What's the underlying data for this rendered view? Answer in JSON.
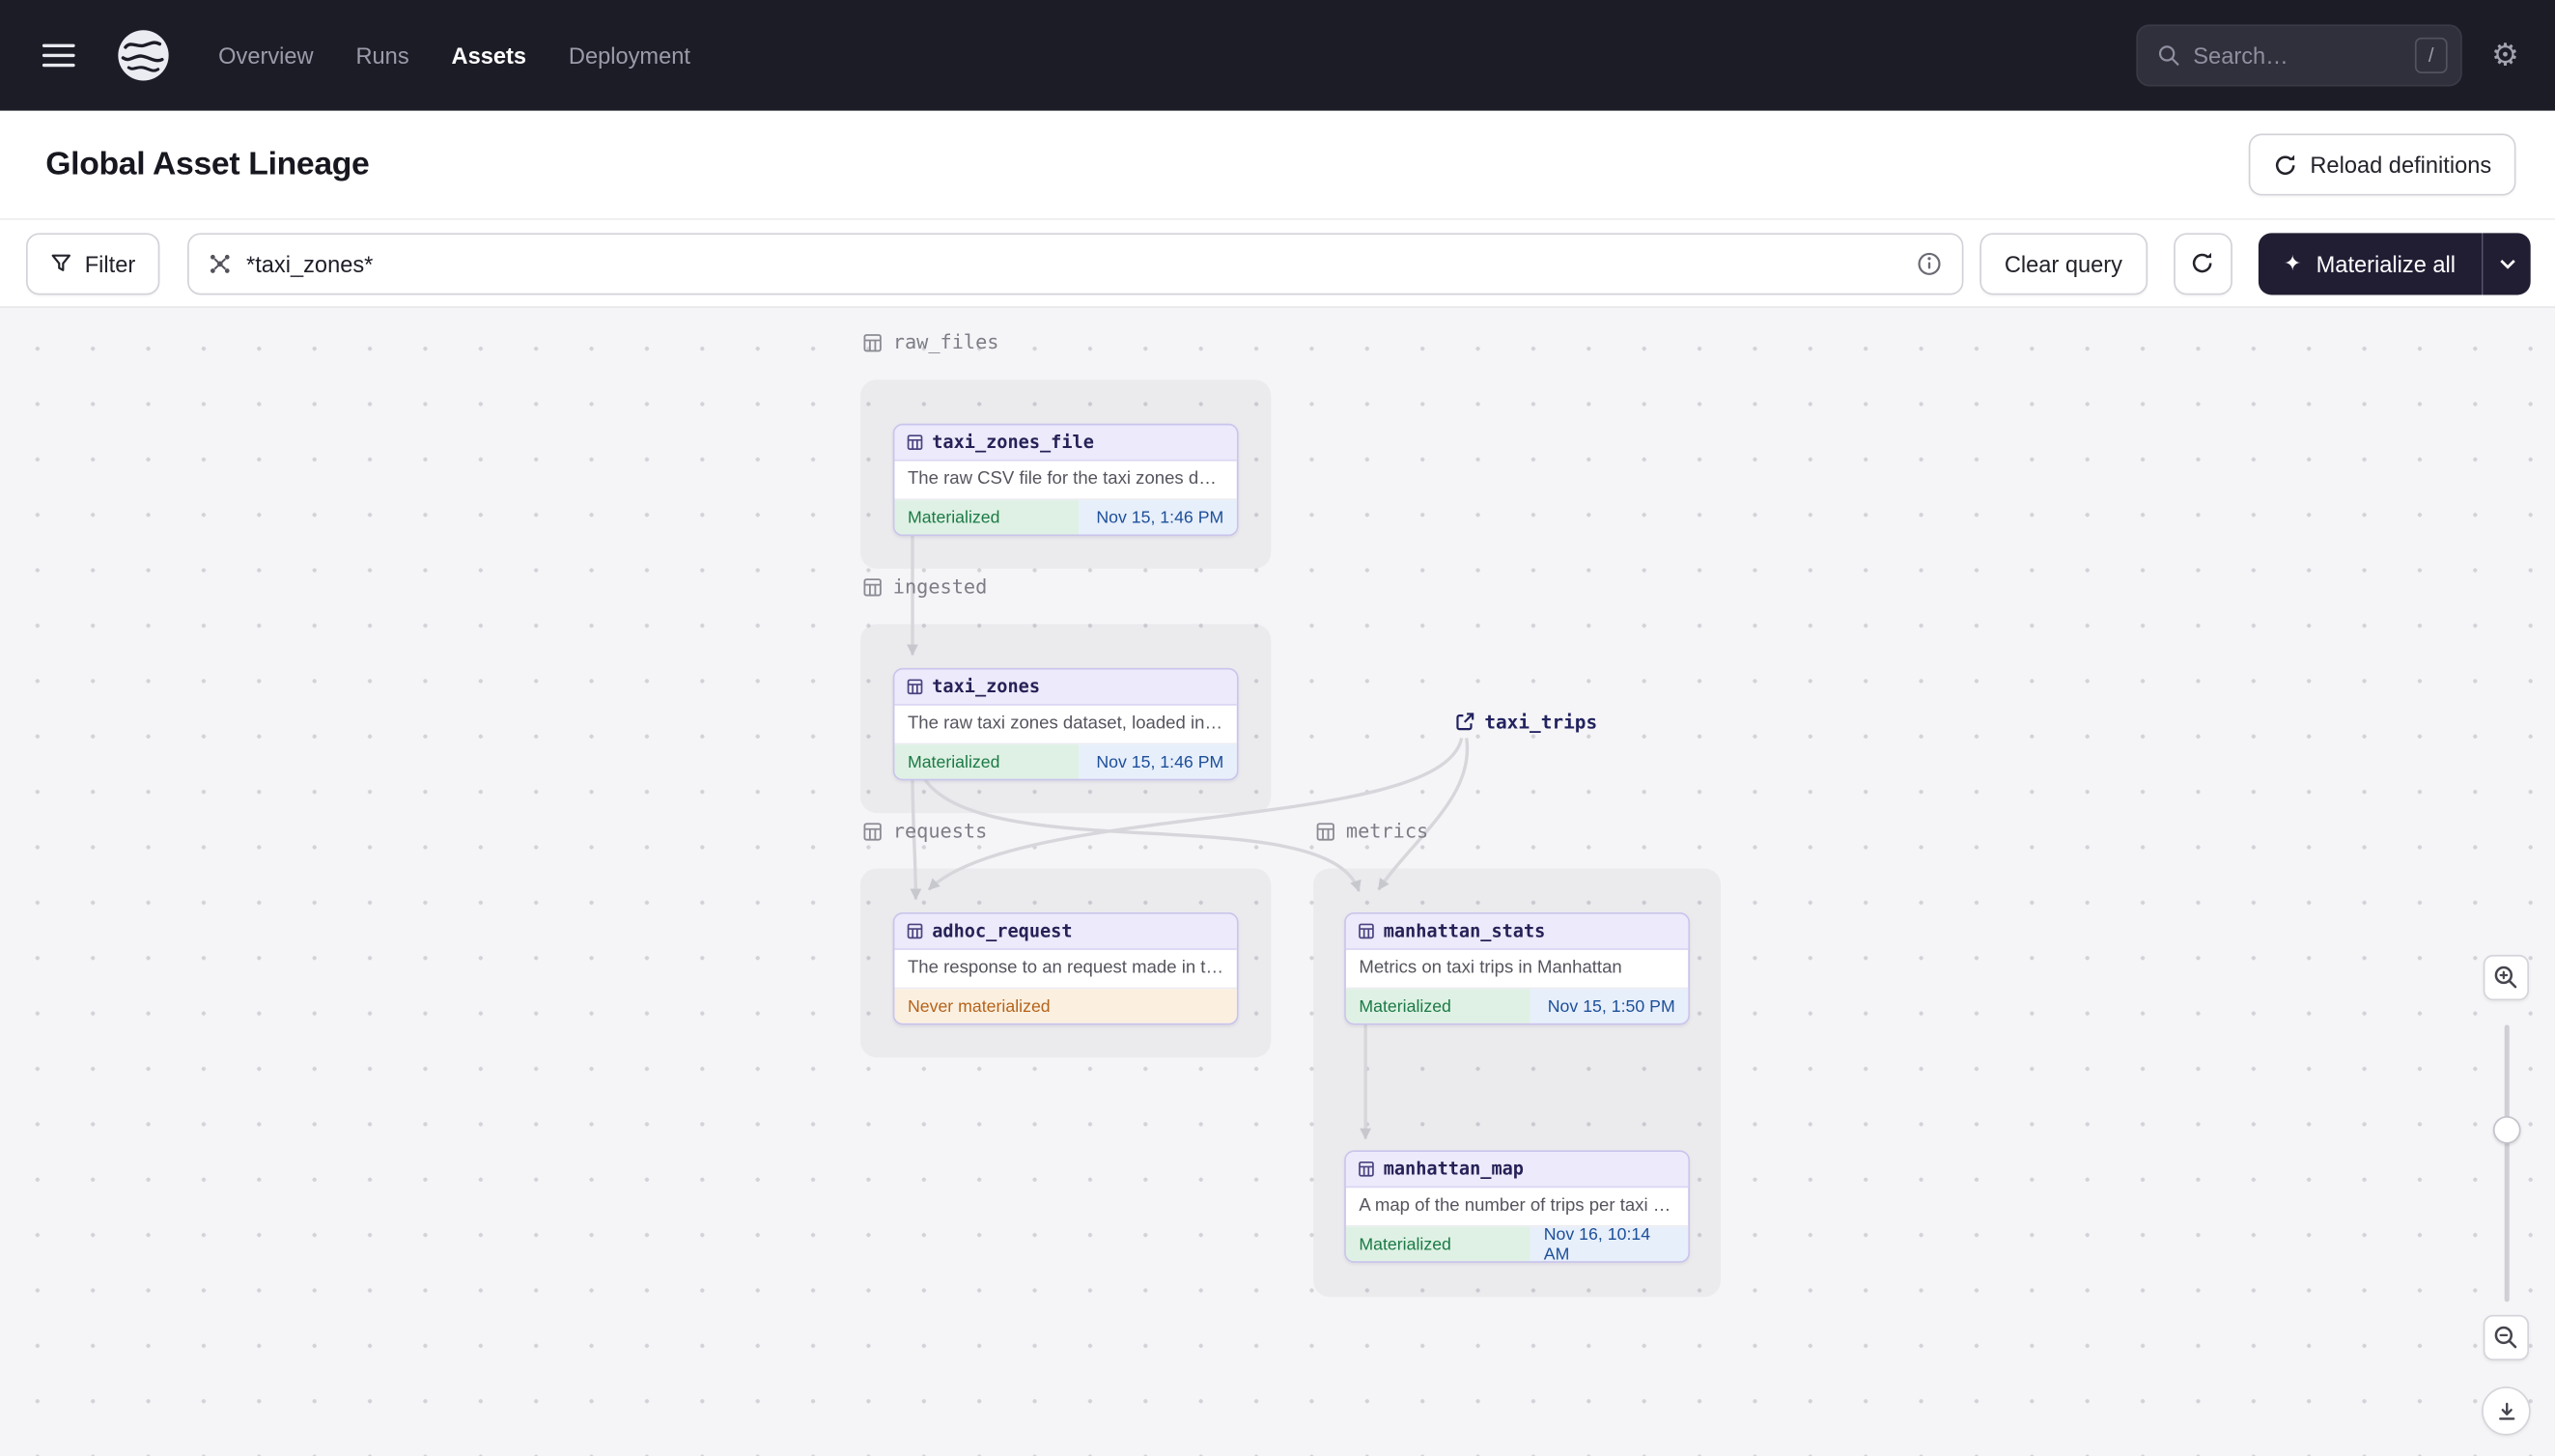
{
  "topbar": {
    "nav_items": [
      {
        "label": "Overview"
      },
      {
        "label": "Runs"
      },
      {
        "label": "Assets"
      },
      {
        "label": "Deployment"
      }
    ],
    "search_placeholder": "Search…",
    "search_shortcut": "/"
  },
  "header": {
    "title": "Global Asset Lineage",
    "reload_button_label": "Reload definitions"
  },
  "toolbar": {
    "filter_label": "Filter",
    "query_value": "*taxi_zones*",
    "clear_query_label": "Clear query",
    "materialize_label": "Materialize all"
  },
  "graph": {
    "groups": [
      {
        "name": "raw_files"
      },
      {
        "name": "ingested"
      },
      {
        "name": "requests"
      },
      {
        "name": "metrics"
      }
    ],
    "external": {
      "name": "taxi_trips"
    },
    "nodes": [
      {
        "name": "taxi_zones_file",
        "description": "The raw CSV file for the taxi zones dat…",
        "status": "Materialized",
        "timestamp": "Nov 15, 1:46 PM"
      },
      {
        "name": "taxi_zones",
        "description": "The raw taxi zones dataset, loaded int…",
        "status": "Materialized",
        "timestamp": "Nov 15, 1:46 PM"
      },
      {
        "name": "adhoc_request",
        "description": "The response to an request made in th…",
        "status": "Never materialized"
      },
      {
        "name": "manhattan_stats",
        "description": "Metrics on taxi trips in Manhattan",
        "status": "Materialized",
        "timestamp": "Nov 15, 1:50 PM"
      },
      {
        "name": "manhattan_map",
        "description": "A map of the number of trips per taxi z…",
        "status": "Materialized",
        "timestamp": "Nov 16, 10:14 AM"
      }
    ]
  },
  "colors": {
    "topbar_bg": "#1c1c27",
    "node_header_lavender": "#eceafb",
    "materialized_green_text": "#1b7a46",
    "timestamp_blue_text": "#1d4f99",
    "never_materialized_orange_text": "#b5631b",
    "materialize_button_bg": "#211e34"
  }
}
